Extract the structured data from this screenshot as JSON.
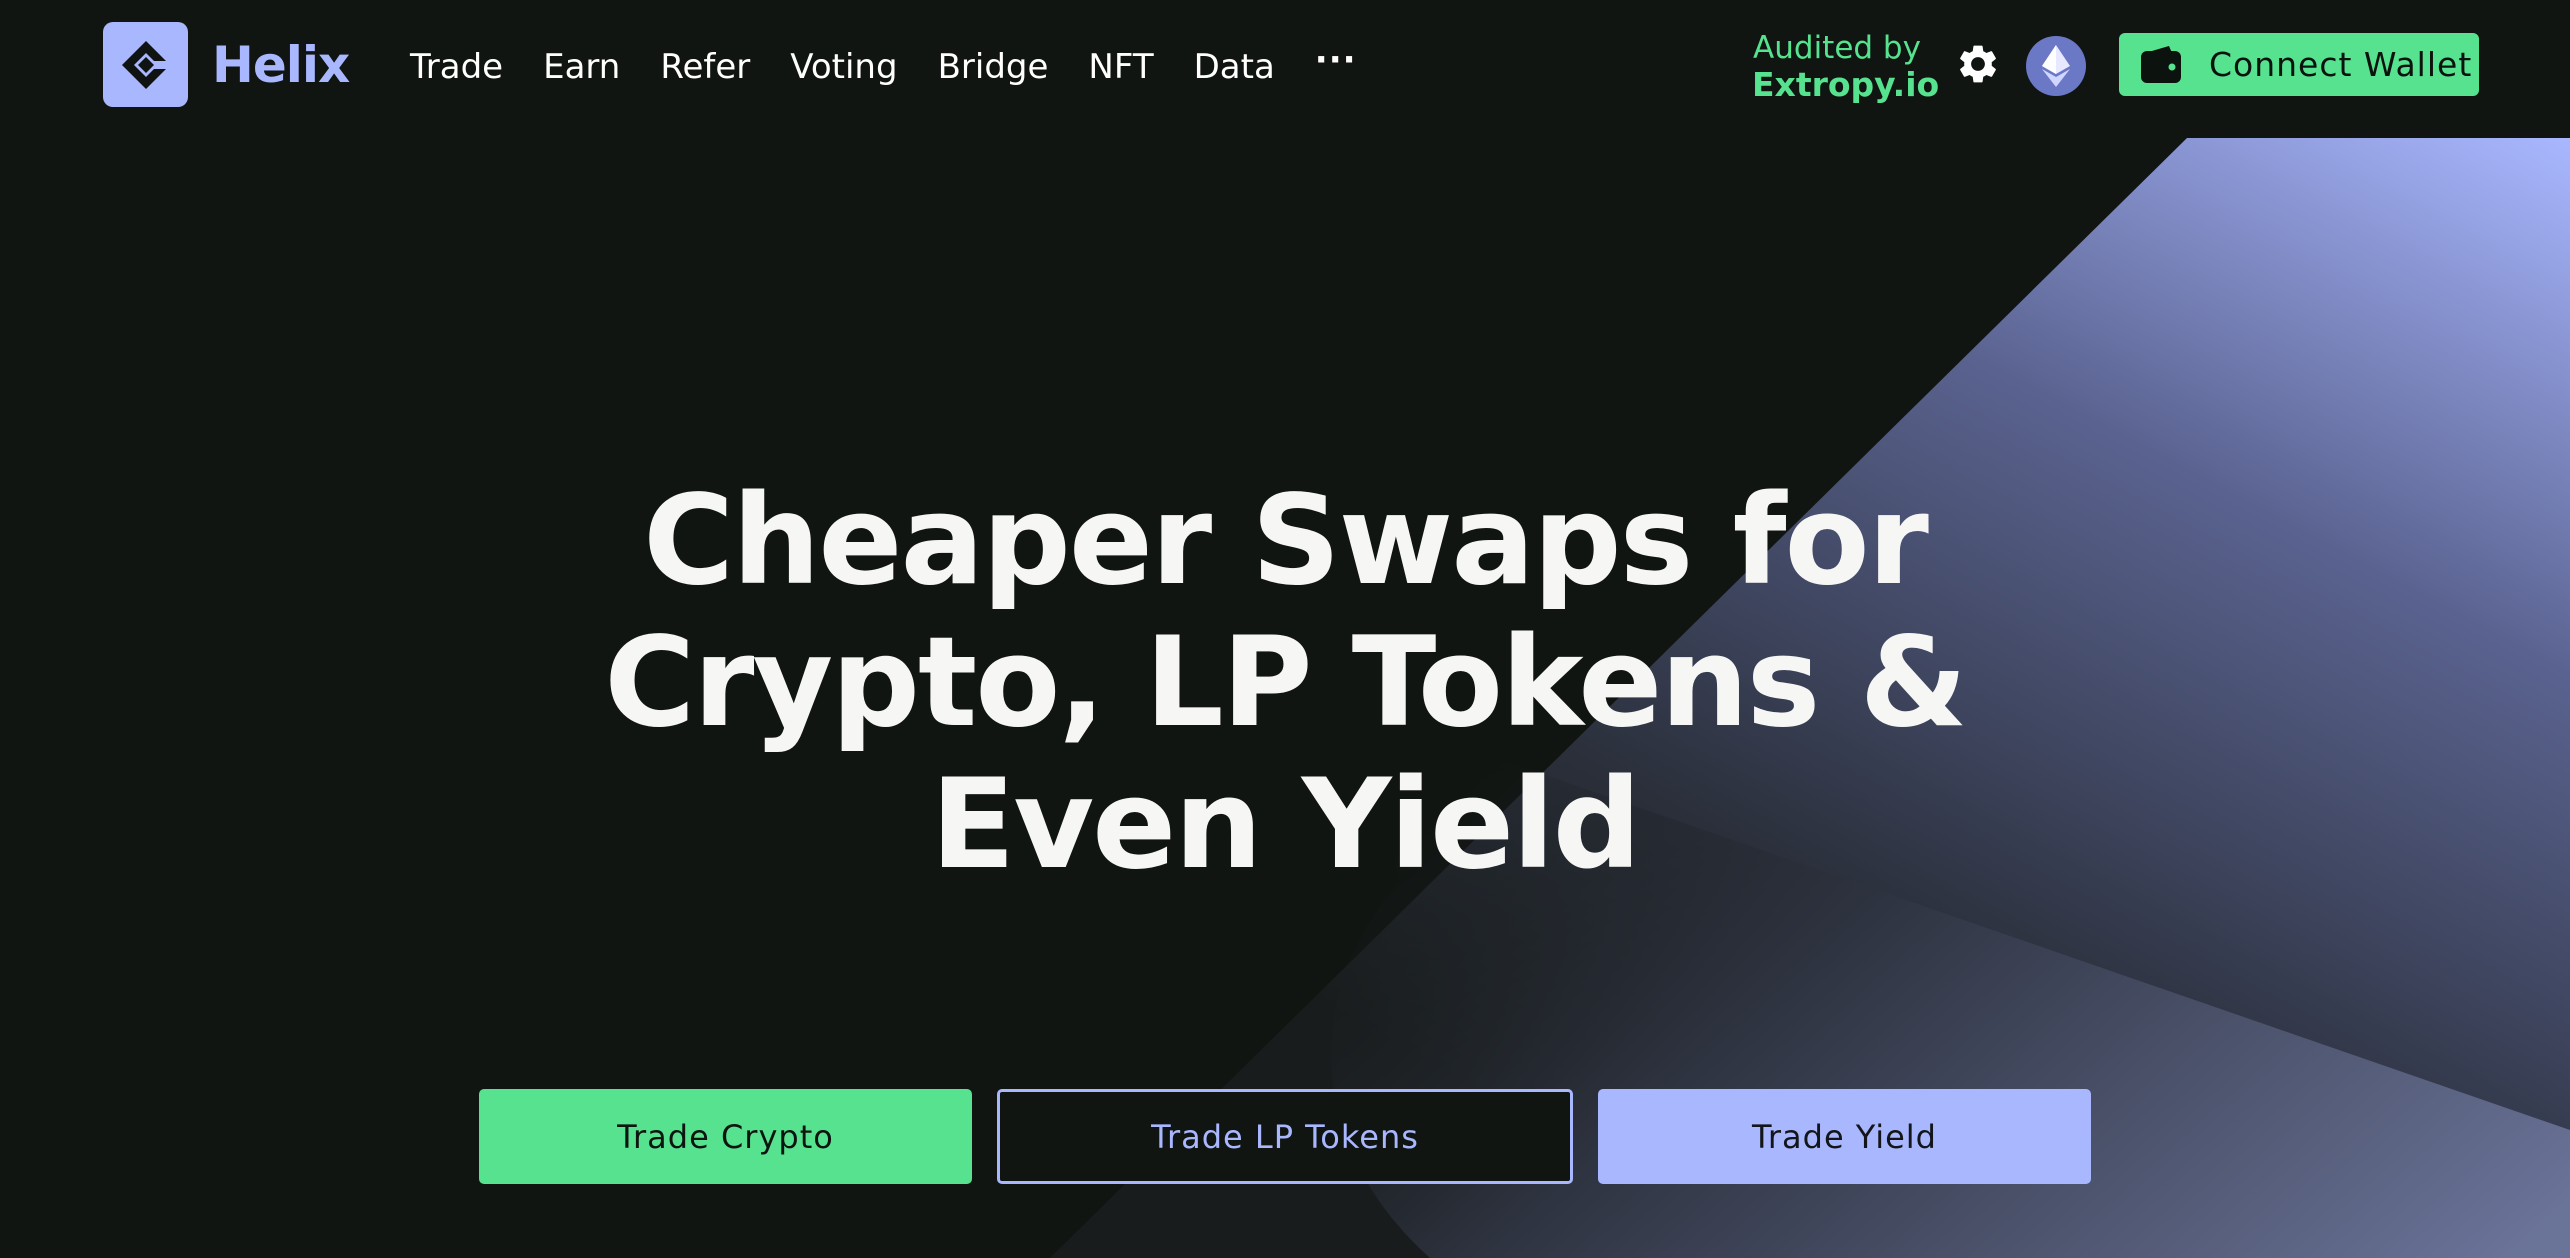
{
  "brand": {
    "name": "Helix",
    "logo_icon": "helix-logo-icon",
    "accent_color": "#a9b7ff"
  },
  "nav": {
    "items": [
      {
        "label": "Trade"
      },
      {
        "label": "Earn"
      },
      {
        "label": "Refer"
      },
      {
        "label": "Voting"
      },
      {
        "label": "Bridge"
      },
      {
        "label": "NFT"
      },
      {
        "label": "Data"
      }
    ],
    "more_label": "···"
  },
  "audit": {
    "label": "Audited by",
    "name": "Extropy.io",
    "color": "#56e28e"
  },
  "header_actions": {
    "settings_icon": "gear-icon",
    "network_icon": "ethereum-icon",
    "wallet_icon": "wallet-icon",
    "connect_label": "Connect Wallet",
    "connect_color": "#56e28e"
  },
  "hero": {
    "lines": [
      "Cheaper Swaps for",
      "Crypto, LP Tokens &",
      "Even Yield"
    ]
  },
  "cta": {
    "trade_crypto": "Trade Crypto",
    "trade_lp": "Trade LP Tokens",
    "trade_yield": "Trade Yield"
  },
  "colors": {
    "background": "#111512",
    "green": "#56e28e",
    "purple": "#a9b7ff"
  }
}
